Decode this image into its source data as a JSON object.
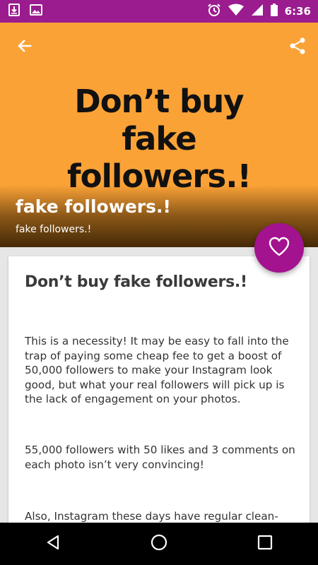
{
  "status_bar": {
    "time": "6:36",
    "icons": [
      "download-icon",
      "image-icon",
      "alarm-icon",
      "wifi-icon",
      "signal-icon",
      "battery-icon"
    ]
  },
  "hero": {
    "image_text_lines": [
      "Don’t buy",
      "fake",
      "followers.!"
    ],
    "title": "fake followers.!",
    "subtitle": "fake followers.!",
    "background_color": "#fba237"
  },
  "article": {
    "title": "Don’t buy fake followers.!",
    "paragraphs": [
      "This is a necessity! It may be easy to fall into the trap of paying some cheap fee to get a boost of 50,000 followers to make your Instagram look good, but what your real followers will pick up is the lack of engagement on your photos.",
      "55,000 followers with 50 likes and 3 comments on each photo isn’t very convincing!",
      "Also, Instagram these days have regular clean-"
    ]
  },
  "colors": {
    "status_bar": "#9a1c8f",
    "fab": "#a3128f",
    "nav_bar": "#000000"
  }
}
